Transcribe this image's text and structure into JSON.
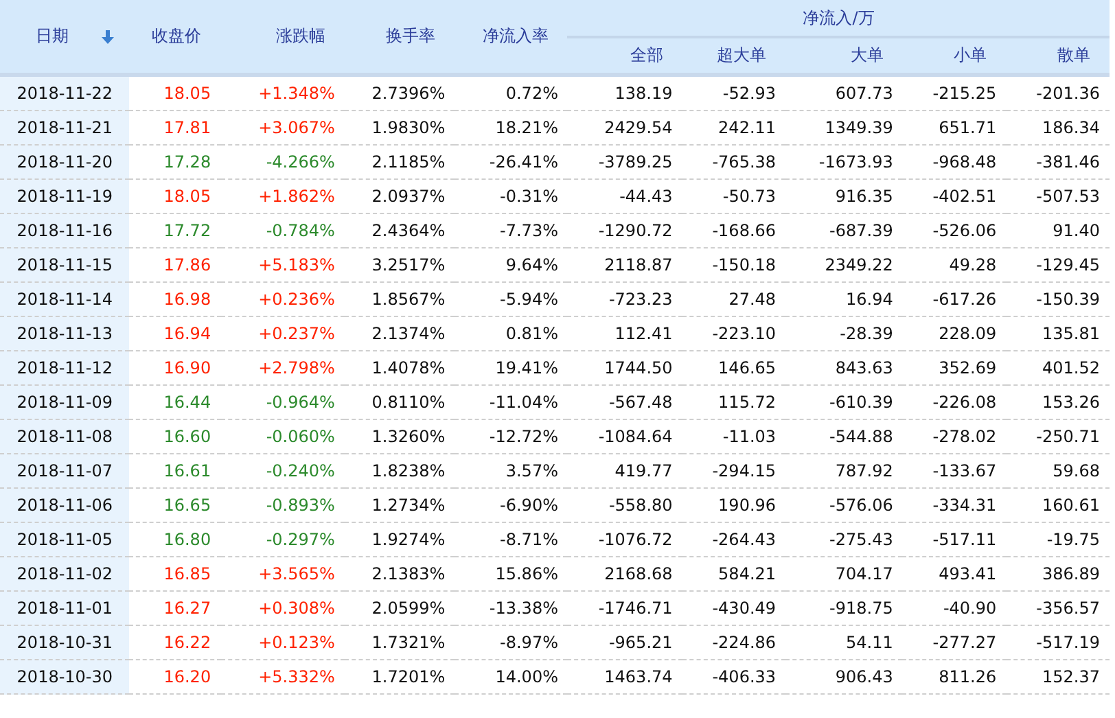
{
  "table": {
    "columns": [
      {
        "label": "日期",
        "sorted": true
      },
      {
        "label": "收盘价"
      },
      {
        "label": "涨跌幅"
      },
      {
        "label": "换手率"
      },
      {
        "label": "净流入率"
      }
    ],
    "group": {
      "label": "净流入/万",
      "columns": [
        "全部",
        "超大单",
        "大单",
        "小单",
        "散单"
      ]
    },
    "rows": [
      {
        "rising": true,
        "cells": [
          "2018-11-22",
          "18.05",
          "+1.348%",
          "2.7396%",
          "0.72%",
          "138.19",
          "-52.93",
          "607.73",
          "-215.25",
          "-201.36"
        ]
      },
      {
        "rising": true,
        "cells": [
          "2018-11-21",
          "17.81",
          "+3.067%",
          "1.9830%",
          "18.21%",
          "2429.54",
          "242.11",
          "1349.39",
          "651.71",
          "186.34"
        ]
      },
      {
        "rising": false,
        "cells": [
          "2018-11-20",
          "17.28",
          "-4.266%",
          "2.1185%",
          "-26.41%",
          "-3789.25",
          "-765.38",
          "-1673.93",
          "-968.48",
          "-381.46"
        ]
      },
      {
        "rising": true,
        "cells": [
          "2018-11-19",
          "18.05",
          "+1.862%",
          "2.0937%",
          "-0.31%",
          "-44.43",
          "-50.73",
          "916.35",
          "-402.51",
          "-507.53"
        ]
      },
      {
        "rising": false,
        "cells": [
          "2018-11-16",
          "17.72",
          "-0.784%",
          "2.4364%",
          "-7.73%",
          "-1290.72",
          "-168.66",
          "-687.39",
          "-526.06",
          "91.40"
        ]
      },
      {
        "rising": true,
        "cells": [
          "2018-11-15",
          "17.86",
          "+5.183%",
          "3.2517%",
          "9.64%",
          "2118.87",
          "-150.18",
          "2349.22",
          "49.28",
          "-129.45"
        ]
      },
      {
        "rising": true,
        "cells": [
          "2018-11-14",
          "16.98",
          "+0.236%",
          "1.8567%",
          "-5.94%",
          "-723.23",
          "27.48",
          "16.94",
          "-617.26",
          "-150.39"
        ]
      },
      {
        "rising": true,
        "cells": [
          "2018-11-13",
          "16.94",
          "+0.237%",
          "2.1374%",
          "0.81%",
          "112.41",
          "-223.10",
          "-28.39",
          "228.09",
          "135.81"
        ]
      },
      {
        "rising": true,
        "cells": [
          "2018-11-12",
          "16.90",
          "+2.798%",
          "1.4078%",
          "19.41%",
          "1744.50",
          "146.65",
          "843.63",
          "352.69",
          "401.52"
        ]
      },
      {
        "rising": false,
        "cells": [
          "2018-11-09",
          "16.44",
          "-0.964%",
          "0.8110%",
          "-11.04%",
          "-567.48",
          "115.72",
          "-610.39",
          "-226.08",
          "153.26"
        ]
      },
      {
        "rising": false,
        "cells": [
          "2018-11-08",
          "16.60",
          "-0.060%",
          "1.3260%",
          "-12.72%",
          "-1084.64",
          "-11.03",
          "-544.88",
          "-278.02",
          "-250.71"
        ]
      },
      {
        "rising": false,
        "cells": [
          "2018-11-07",
          "16.61",
          "-0.240%",
          "1.8238%",
          "3.57%",
          "419.77",
          "-294.15",
          "787.92",
          "-133.67",
          "59.68"
        ]
      },
      {
        "rising": false,
        "cells": [
          "2018-11-06",
          "16.65",
          "-0.893%",
          "1.2734%",
          "-6.90%",
          "-558.80",
          "190.96",
          "-576.06",
          "-334.31",
          "160.61"
        ]
      },
      {
        "rising": false,
        "cells": [
          "2018-11-05",
          "16.80",
          "-0.297%",
          "1.9274%",
          "-8.71%",
          "-1076.72",
          "-264.43",
          "-275.43",
          "-517.11",
          "-19.75"
        ]
      },
      {
        "rising": true,
        "cells": [
          "2018-11-02",
          "16.85",
          "+3.565%",
          "2.1383%",
          "15.86%",
          "2168.68",
          "584.21",
          "704.17",
          "493.41",
          "386.89"
        ]
      },
      {
        "rising": true,
        "cells": [
          "2018-11-01",
          "16.27",
          "+0.308%",
          "2.0599%",
          "-13.38%",
          "-1746.71",
          "-430.49",
          "-918.75",
          "-40.90",
          "-356.57"
        ]
      },
      {
        "rising": true,
        "cells": [
          "2018-10-31",
          "16.22",
          "+0.123%",
          "1.7321%",
          "-8.97%",
          "-965.21",
          "-224.86",
          "54.11",
          "-277.27",
          "-517.19"
        ]
      },
      {
        "rising": true,
        "cells": [
          "2018-10-30",
          "16.20",
          "+5.332%",
          "1.7201%",
          "14.00%",
          "1463.74",
          "-406.33",
          "906.43",
          "811.26",
          "152.37"
        ]
      }
    ]
  }
}
